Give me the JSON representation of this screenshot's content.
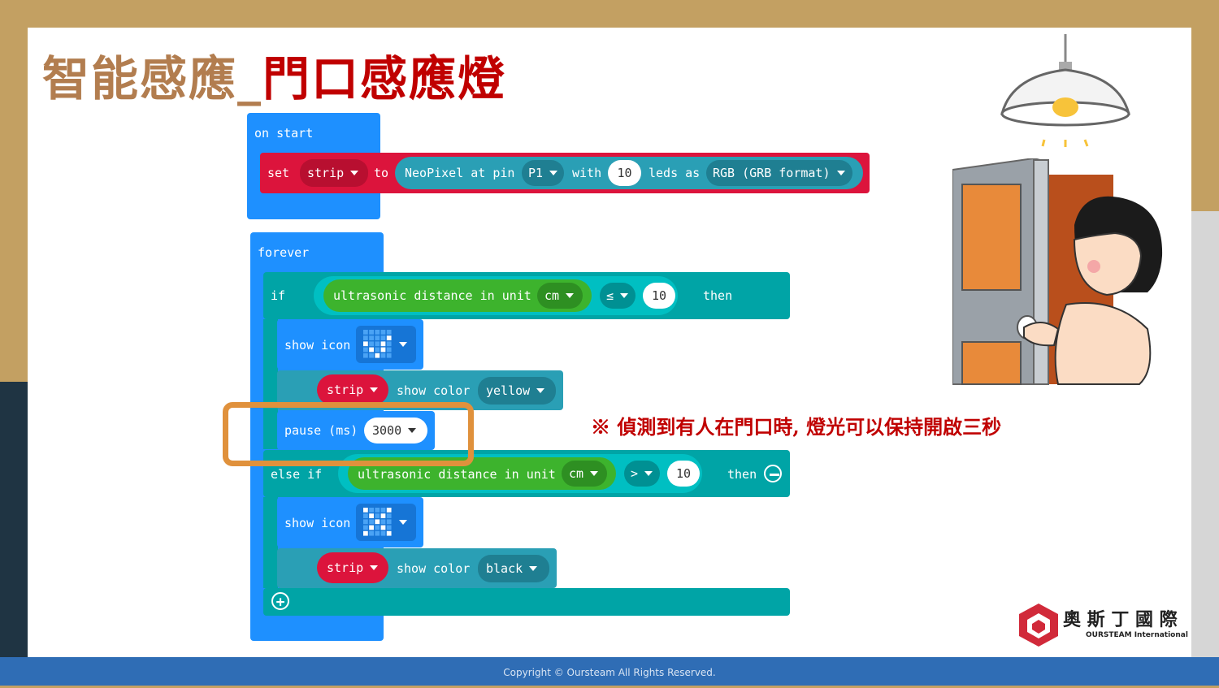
{
  "title": {
    "part1": "智能感應_",
    "part2": "門口感應燈"
  },
  "on_start": {
    "hat": "on start",
    "set": "set",
    "var": "strip",
    "to": "to",
    "neopixel": "NeoPixel at pin",
    "pin": "P1",
    "with": "with",
    "count": "10",
    "leds_as": "leds as",
    "mode": "RGB (GRB format)"
  },
  "forever": {
    "hat": "forever",
    "if": "if",
    "sensor": "ultrasonic distance in unit",
    "unit": "cm",
    "op1": "≤",
    "val1": "10",
    "then": "then",
    "show_icon": "show icon",
    "strip": "strip",
    "show_color": "show color",
    "color1": "yellow",
    "pause": "pause (ms)",
    "pause_val": "3000",
    "else_if": "else if",
    "op2": ">",
    "val2": "10",
    "then2": "then",
    "color2": "black"
  },
  "note": "※ 偵測到有人在門口時, 燈光可以保持開啟三秒",
  "logo": {
    "cn": "奧 斯 丁 國 際",
    "en": "OURSTEAM International"
  },
  "footer": "Copyright © Oursteam All Rights Reserved.",
  "colors": {
    "basic": "#1e90ff",
    "variables": "#dc143c",
    "neopixel": "#2a9fb5",
    "logic": "#00a4a6",
    "sensor": "#3db32d",
    "title_brown": "#b27d4f",
    "title_red": "#c00000",
    "highlight": "#e0913c"
  }
}
